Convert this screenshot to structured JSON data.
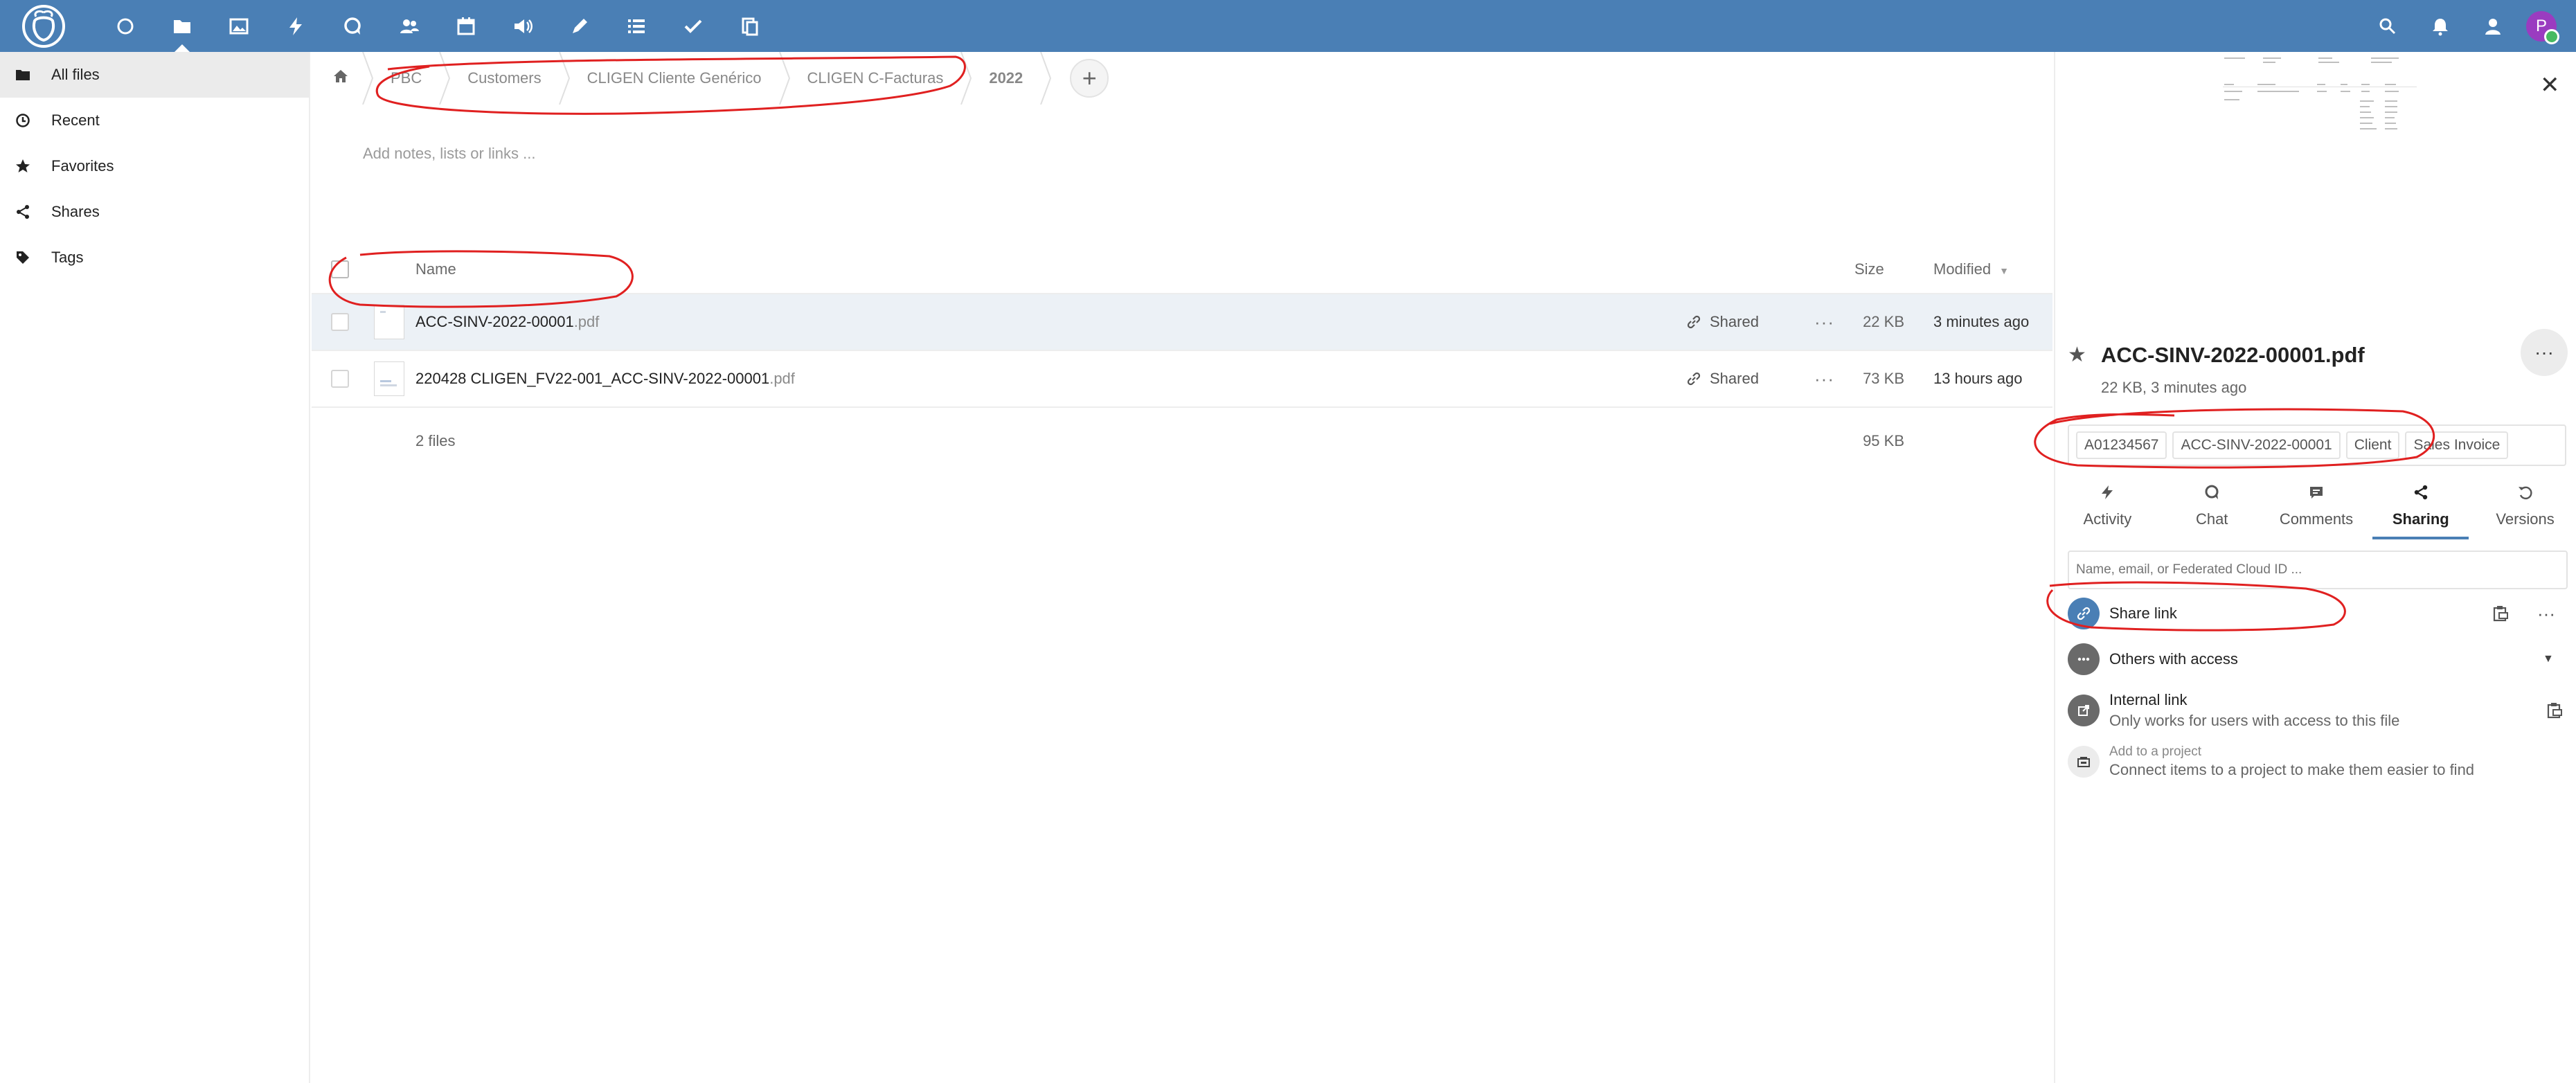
{
  "header": {
    "apps": [
      {
        "name": "dashboard-icon"
      },
      {
        "name": "files-icon",
        "active": true
      },
      {
        "name": "photos-icon"
      },
      {
        "name": "activity-icon"
      },
      {
        "name": "talk-icon"
      },
      {
        "name": "contacts-icon"
      },
      {
        "name": "calendar-icon"
      },
      {
        "name": "audio-icon"
      },
      {
        "name": "notes-icon"
      },
      {
        "name": "tasks-list-icon"
      },
      {
        "name": "deck-icon"
      },
      {
        "name": "documents-icon"
      }
    ],
    "avatar_initial": "P",
    "colors": {
      "header_bg": "#4a7fb5",
      "avatar_bg": "#9a3cc0",
      "status": "#46ba61"
    }
  },
  "sidebar": {
    "items": [
      {
        "label": "All files",
        "icon": "folder-icon"
      },
      {
        "label": "Recent",
        "icon": "clock-icon"
      },
      {
        "label": "Favorites",
        "icon": "star-icon"
      },
      {
        "label": "Shares",
        "icon": "share-icon"
      },
      {
        "label": "Tags",
        "icon": "tag-icon"
      }
    ]
  },
  "breadcrumb": {
    "items": [
      "PBC",
      "Customers",
      "CLIGEN Cliente Genérico",
      "CLIGEN C-Facturas",
      "2022"
    ],
    "add_label": "+"
  },
  "notes_placeholder": "Add notes, lists or links ...",
  "table": {
    "headers": {
      "name": "Name",
      "size": "Size",
      "modified": "Modified"
    },
    "rows": [
      {
        "name": "ACC-SINV-2022-00001",
        "ext": ".pdf",
        "shared": "Shared",
        "size": "22 KB",
        "modified": "3 minutes ago"
      },
      {
        "name": "220428 CLIGEN_FV22-001_ACC-SINV-2022-00001",
        "ext": ".pdf",
        "shared": "Shared",
        "size": "73 KB",
        "modified": "13 hours ago"
      }
    ],
    "summary": {
      "count": "2 files",
      "total": "95 KB"
    }
  },
  "details": {
    "title": "ACC-SINV-2022-00001.pdf",
    "meta": "22 KB, 3 minutes ago",
    "tags": [
      "A01234567",
      "ACC-SINV-2022-00001",
      "Client",
      "Sales Invoice"
    ],
    "tabs": [
      {
        "label": "Activity",
        "icon": "activity-icon"
      },
      {
        "label": "Chat",
        "icon": "chat-icon"
      },
      {
        "label": "Comments",
        "icon": "comment-icon"
      },
      {
        "label": "Sharing",
        "icon": "share-icon",
        "active": true
      },
      {
        "label": "Versions",
        "icon": "history-icon"
      }
    ],
    "share_placeholder": "Name, email, or Federated Cloud ID ...",
    "share_link": "Share link",
    "others_access": "Others with access",
    "internal_link": "Internal link",
    "internal_link_sub": "Only works for users with access to this file",
    "add_project": "Add to a project",
    "add_project_sub": "Connect items to a project to make them easier to find"
  }
}
